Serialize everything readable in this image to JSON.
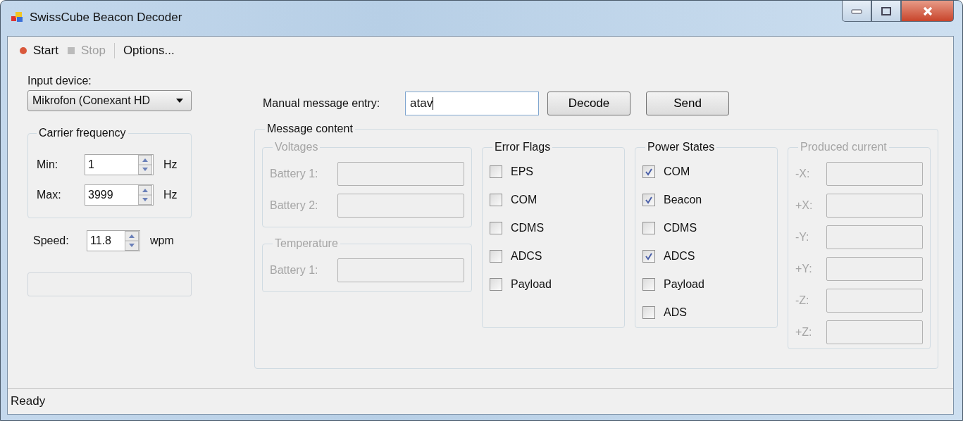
{
  "window": {
    "title": "SwissCube Beacon Decoder"
  },
  "toolbar": [
    {
      "label": "Start",
      "kind": "start",
      "disabled": false
    },
    {
      "label": "Stop",
      "kind": "stop",
      "disabled": true
    },
    {
      "label": "Options...",
      "kind": "options",
      "disabled": false
    }
  ],
  "input_device": {
    "label": "Input device:",
    "value": "Mikrofon (Conexant HD"
  },
  "carrier_frequency": {
    "title": "Carrier frequency",
    "rows": [
      {
        "label": "Min:",
        "value": "1",
        "unit": "Hz"
      },
      {
        "label": "Max:",
        "value": "3999",
        "unit": "Hz"
      }
    ]
  },
  "speed": {
    "label": "Speed:",
    "value": "11.8",
    "unit": "wpm"
  },
  "manual_entry": {
    "label": "Manual message entry:",
    "value": "atav"
  },
  "buttons": [
    "Decode",
    "Send"
  ],
  "message_content": {
    "title": "Message content",
    "columns": [
      {
        "groups": [
          {
            "kind": "fields",
            "title": "Voltages",
            "disabled": true,
            "items": [
              {
                "label": "Battery 1:"
              },
              {
                "label": "Battery 2:"
              }
            ]
          },
          {
            "kind": "fields",
            "title": "Temperature",
            "disabled": true,
            "items": [
              {
                "label": "Battery 1:"
              }
            ]
          }
        ]
      },
      {
        "groups": [
          {
            "kind": "checks",
            "title": "Error Flags",
            "disabled": false,
            "items": [
              {
                "label": "EPS",
                "checked": false
              },
              {
                "label": "COM",
                "checked": false
              },
              {
                "label": "CDMS",
                "checked": false
              },
              {
                "label": "ADCS",
                "checked": false
              },
              {
                "label": "Payload",
                "checked": false
              }
            ]
          }
        ]
      },
      {
        "groups": [
          {
            "kind": "checks",
            "title": "Power States",
            "disabled": false,
            "items": [
              {
                "label": "COM",
                "checked": true
              },
              {
                "label": "Beacon",
                "checked": true
              },
              {
                "label": "CDMS",
                "checked": false
              },
              {
                "label": "ADCS",
                "checked": true
              },
              {
                "label": "Payload",
                "checked": false
              },
              {
                "label": "ADS",
                "checked": false
              }
            ]
          }
        ]
      },
      {
        "groups": [
          {
            "kind": "fields",
            "title": "Produced current",
            "disabled": true,
            "items": [
              {
                "label": "-X:"
              },
              {
                "label": "+X:"
              },
              {
                "label": "-Y:"
              },
              {
                "label": "+Y:"
              },
              {
                "label": "-Z:"
              },
              {
                "label": "+Z:"
              }
            ]
          }
        ]
      }
    ]
  },
  "status_bar": "Ready"
}
